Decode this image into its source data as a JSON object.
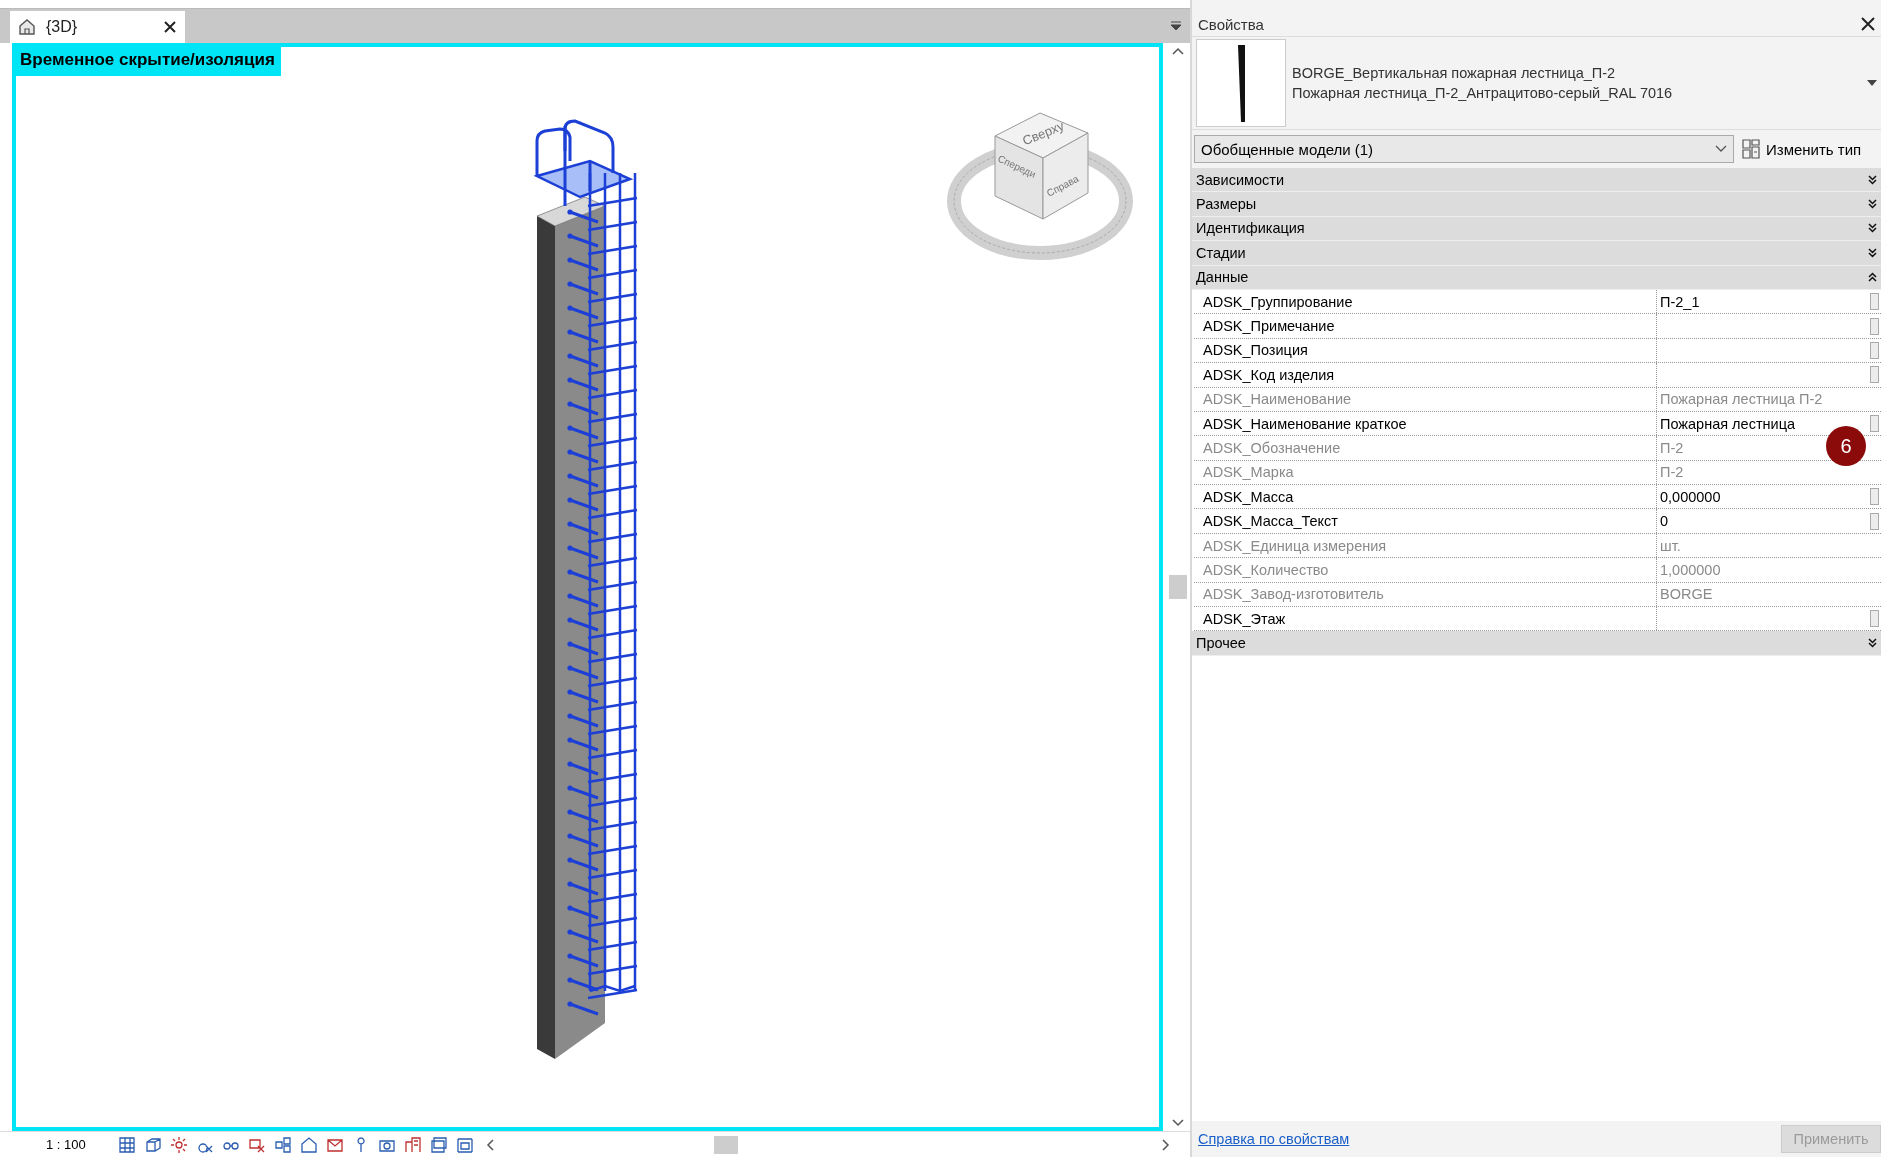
{
  "view_tab": {
    "title": "{3D}"
  },
  "view": {
    "banner": "Временное скрытие/изоляция",
    "viewcube": {
      "top": "Сверху",
      "front": "Спереди",
      "right": "Справа"
    },
    "scale": "1 : 100"
  },
  "properties": {
    "title": "Свойства",
    "type": {
      "family": "BORGE_Вертикальная пожарная лестница_П-2",
      "name": "Пожарная лестница_П-2_Антрацитово-серый_RAL 7016"
    },
    "filter": "Обобщенные модели (1)",
    "edit_type": "Изменить тип",
    "groups": [
      {
        "name": "Зависимости",
        "expanded": false
      },
      {
        "name": "Размеры",
        "expanded": false
      },
      {
        "name": "Идентификация",
        "expanded": false
      },
      {
        "name": "Стадии",
        "expanded": false
      },
      {
        "name": "Данные",
        "expanded": true,
        "rows": [
          {
            "name": "ADSK_Группирование",
            "value": "П-2_1",
            "read_only": false
          },
          {
            "name": "ADSK_Примечание",
            "read_only": false
          },
          {
            "name": "ADSK_Позиция",
            "read_only": false
          },
          {
            "name": "ADSK_Код изделия",
            "read_only": false
          },
          {
            "name": "ADSK_Наименование",
            "value": "Пожарная лестница П-2",
            "read_only": true
          },
          {
            "name": "ADSK_Наименование краткое",
            "value": "Пожарная лестница",
            "read_only": false
          },
          {
            "name": "ADSK_Обозначение",
            "value": "П-2",
            "read_only": true
          },
          {
            "name": "ADSK_Марка",
            "value": "П-2",
            "read_only": true
          },
          {
            "name": "ADSK_Масса",
            "value": "0,000000",
            "read_only": false
          },
          {
            "name": "ADSK_Масса_Текст",
            "value": "0",
            "read_only": false
          },
          {
            "name": "ADSK_Единица измерения",
            "value": "шт.",
            "read_only": true
          },
          {
            "name": "ADSK_Количество",
            "value": "1,000000",
            "read_only": true
          },
          {
            "name": "ADSK_Завод-изготовитель",
            "value": "BORGE",
            "read_only": true
          },
          {
            "name": "ADSK_Этаж",
            "read_only": false
          }
        ]
      },
      {
        "name": "Прочее",
        "expanded": false
      }
    ],
    "help_link": "Справка по свойствам",
    "apply": {
      "label": "Применить",
      "disabled": true
    }
  },
  "annotation": {
    "label": "6"
  }
}
